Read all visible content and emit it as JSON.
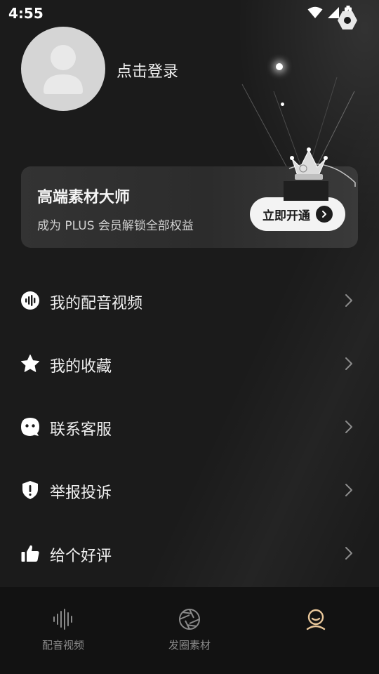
{
  "status_bar": {
    "time": "4:55"
  },
  "profile": {
    "login_text": "点击登录"
  },
  "vip_card": {
    "title": "高端素材大师",
    "subtitle": "成为 PLUS 会员解锁全部权益",
    "button_label": "立即开通"
  },
  "menu": [
    {
      "label": "我的配音视频",
      "icon": "audio-wave-icon"
    },
    {
      "label": "我的收藏",
      "icon": "star-icon"
    },
    {
      "label": "联系客服",
      "icon": "customer-service-icon"
    },
    {
      "label": "举报投诉",
      "icon": "shield-alert-icon"
    },
    {
      "label": "给个好评",
      "icon": "thumbs-up-icon"
    }
  ],
  "tab_bar": {
    "tabs": [
      {
        "label": "配音视频",
        "icon": "sound-wave-icon",
        "active": false
      },
      {
        "label": "发圈素材",
        "icon": "aperture-icon",
        "active": false
      },
      {
        "label": "",
        "icon": "profile-icon",
        "active": true
      }
    ],
    "active_color": "#e9c79a"
  }
}
